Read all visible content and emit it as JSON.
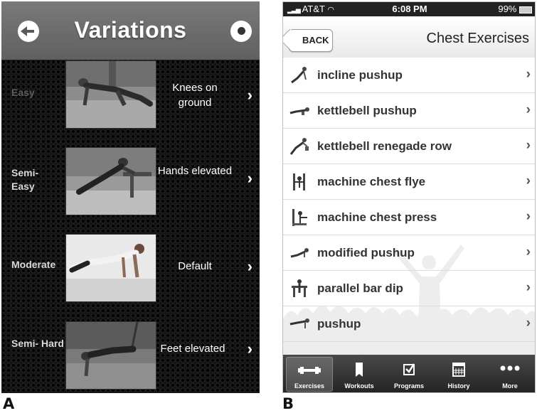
{
  "panel_a": {
    "title": "Variations",
    "variations": [
      {
        "level": "Easy",
        "description": "Knees on ground"
      },
      {
        "level": "Semi- Easy",
        "description": "Hands elevated"
      },
      {
        "level": "Moderate",
        "description": "Default"
      },
      {
        "level": "Semi- Hard",
        "description": "Feet elevated"
      }
    ]
  },
  "panel_b": {
    "status": {
      "carrier": "AT&T",
      "time": "6:08 PM",
      "battery": "99%"
    },
    "back_label": "BACK",
    "title": "Chest Exercises",
    "exercises": [
      "incline pushup",
      "kettlebell pushup",
      "kettlebell renegade row",
      "machine chest flye",
      "machine chest press",
      "modified pushup",
      "parallel bar dip",
      "pushup"
    ],
    "tabs": [
      {
        "label": "Exercises",
        "icon": "dumbbell-icon",
        "selected": true
      },
      {
        "label": "Workouts",
        "icon": "bookmark-icon",
        "selected": false
      },
      {
        "label": "Programs",
        "icon": "checkbox-icon",
        "selected": false
      },
      {
        "label": "History",
        "icon": "calendar-icon",
        "selected": false
      },
      {
        "label": "More",
        "icon": "more-dots-icon",
        "selected": false
      }
    ]
  },
  "captions": {
    "a": "A",
    "b": "B"
  }
}
